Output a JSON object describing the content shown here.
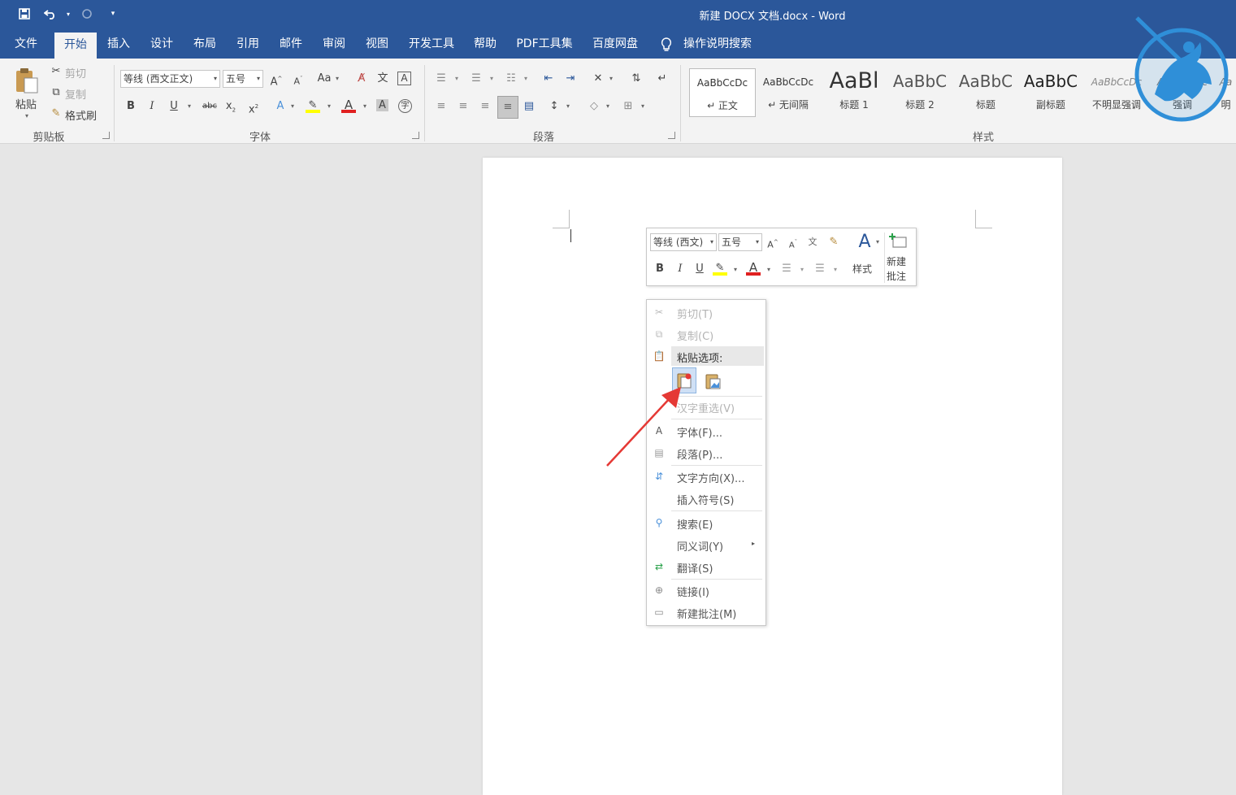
{
  "window": {
    "title": "新建 DOCX 文档.docx  -  Word",
    "qat": {
      "save_icon": "save-icon",
      "undo_icon": "undo-icon",
      "redo_icon": "redo-icon",
      "customize": "▾"
    }
  },
  "tabs": [
    "文件",
    "开始",
    "插入",
    "设计",
    "布局",
    "引用",
    "邮件",
    "审阅",
    "视图",
    "开发工具",
    "帮助",
    "PDF工具集",
    "百度网盘"
  ],
  "active_tab": "开始",
  "tell_me": "操作说明搜索",
  "ribbon": {
    "clipboard": {
      "paste": "粘贴",
      "cut": "剪切",
      "copy": "复制",
      "format_painter": "格式刷",
      "group": "剪贴板"
    },
    "font": {
      "font_name": "等线 (西文正文)",
      "font_size": "五号",
      "group": "字体",
      "case": "Aa"
    },
    "paragraph": {
      "group": "段落"
    },
    "styles": {
      "group": "样式",
      "items": [
        {
          "sample": "AaBbCcDc",
          "name": "↵ 正文"
        },
        {
          "sample": "AaBbCcDc",
          "name": "↵ 无间隔"
        },
        {
          "sample": "AaBl",
          "name": "标题 1"
        },
        {
          "sample": "AaBbC",
          "name": "标题 2"
        },
        {
          "sample": "AaBbC",
          "name": "标题"
        },
        {
          "sample": "AaBbC",
          "name": "副标题"
        },
        {
          "sample": "AaBbCcDc",
          "name": "不明显强调"
        },
        {
          "sample": "AaBbCcDc",
          "name": "强调"
        },
        {
          "sample": "Aa",
          "name": "明"
        }
      ]
    }
  },
  "mini_toolbar": {
    "font_name": "等线 (西文)",
    "font_size": "五号",
    "styles_label": "样式",
    "new_comment_line1": "新建",
    "new_comment_line2": "批注"
  },
  "context_menu": {
    "cut": "剪切(T)",
    "copy": "复制(C)",
    "paste_options": "粘贴选项:",
    "hanzi": "汉字重选(V)",
    "font": "字体(F)...",
    "paragraph": "段落(P)...",
    "text_direction": "文字方向(X)...",
    "insert_symbol": "插入符号(S)",
    "search": "搜索(E)",
    "synonyms": "同义词(Y)",
    "translate": "翻译(S)",
    "link": "链接(I)",
    "new_comment": "新建批注(M)"
  },
  "colors": {
    "accent": "#2b579a",
    "arrow": "#e53935",
    "logo": "#2f8fd8"
  }
}
